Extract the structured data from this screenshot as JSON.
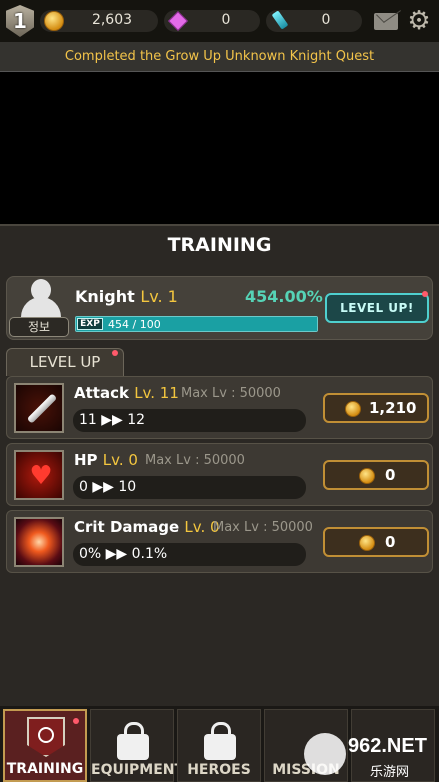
{
  "header": {
    "rank_level": "1",
    "gold": "2,603",
    "gems": "0",
    "crystals": "0",
    "icons": {
      "rank": "rank-shield-icon",
      "gold": "gold-coin-icon",
      "gems": "pink-gem-icon",
      "crystals": "blue-crystal-icon",
      "mail": "mail-icon",
      "settings": "gear-icon"
    }
  },
  "quest": {
    "text": "Completed the Grow Up Unknown Knight Quest",
    "color": "#f3c44a"
  },
  "training": {
    "title": "TRAINING",
    "hero": {
      "name": "Knight",
      "level": "Lv. 1",
      "percent": "454.00%",
      "exp_tag": "EXP",
      "exp_text": "454 / 100",
      "exp_fill_fraction": 1.0,
      "info_button": "정보",
      "levelup_button": "LEVEL UP!"
    },
    "tab_label": "LEVEL UP",
    "skills": [
      {
        "name": "Attack",
        "level": "Lv. 11",
        "max": "Max Lv : 50000",
        "progress": "11 ▶▶ 12",
        "cost": "1,210",
        "icon": "sword-icon"
      },
      {
        "name": "HP",
        "level": "Lv. 0",
        "max": "Max Lv : 50000",
        "progress": "0 ▶▶ 10",
        "cost": "0",
        "icon": "heart-icon"
      },
      {
        "name": "Crit Damage",
        "level": "Lv. 0",
        "max": "Max Lv : 50000",
        "progress": "0% ▶▶ 0.1%",
        "cost": "0",
        "icon": "crit-burst-icon"
      }
    ]
  },
  "nav": {
    "tabs": [
      {
        "label": "TRAINING",
        "active": true,
        "locked": false
      },
      {
        "label": "EQUIPMENT",
        "active": false,
        "locked": true
      },
      {
        "label": "HEROES",
        "active": false,
        "locked": true
      },
      {
        "label": "MISSION",
        "active": false,
        "locked": false
      }
    ]
  },
  "watermark": {
    "text": "962.NET",
    "subtext": "乐游网"
  },
  "colors": {
    "accent_gold": "#f3c63f",
    "teal": "#56d3b6",
    "panel": "#2b2824"
  }
}
